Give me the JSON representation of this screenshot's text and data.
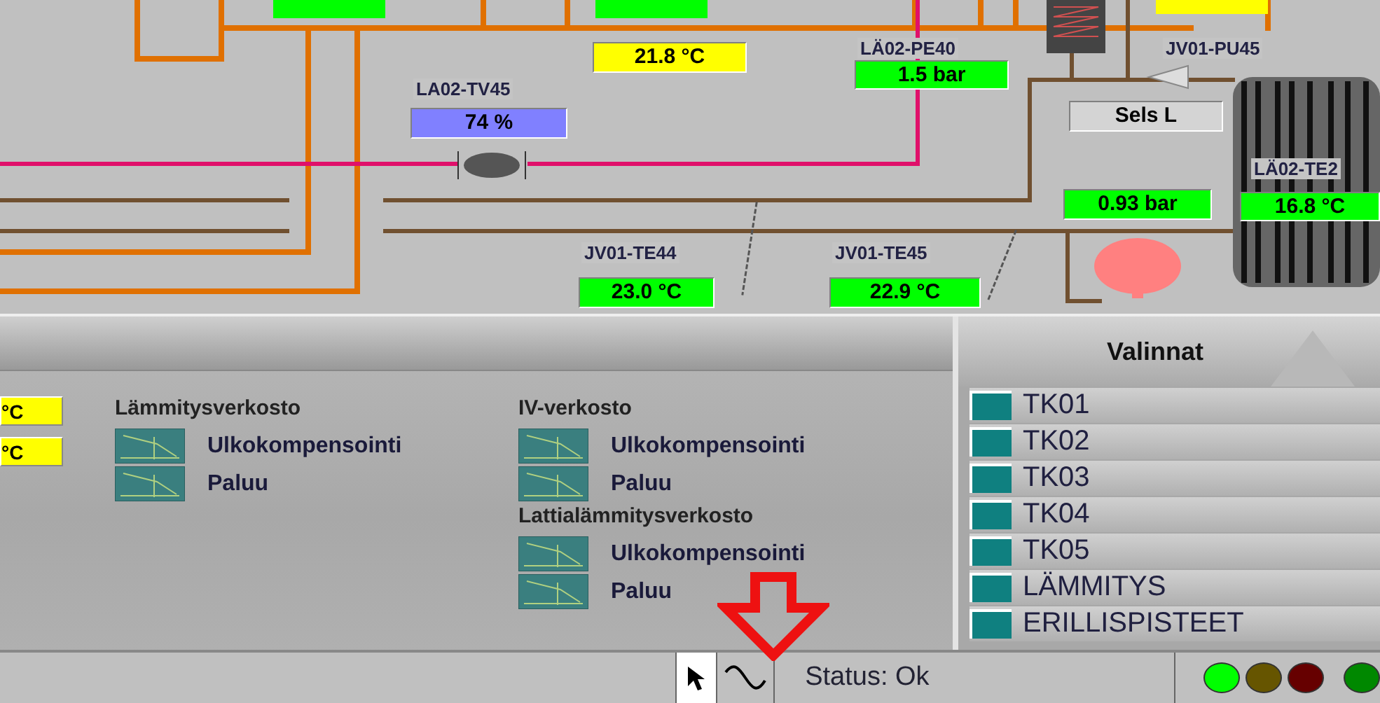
{
  "schematic": {
    "readouts": [
      {
        "value": "21.8 °C",
        "color": "#ffff00"
      },
      {
        "label": "LA02-TV45",
        "value": "74 %",
        "color": "#8080ff"
      },
      {
        "label": "LÄ02-PE40",
        "value": "1.5 bar",
        "color": "#00ff00"
      },
      {
        "label": "JV01-PU45",
        "value": "Sels L",
        "color": "#d4d4d4"
      },
      {
        "value": "0.93 bar",
        "color": "#00ff00"
      },
      {
        "label": "LÄ02-TE2",
        "value": "16.8 °C",
        "color": "#00ff00"
      },
      {
        "label": "JV01-TE44",
        "value": "23.0 °C",
        "color": "#00ff00"
      },
      {
        "label": "JV01-TE45",
        "value": "22.9 °C",
        "color": "#00ff00"
      }
    ]
  },
  "networks": {
    "side_readouts": [
      "°C",
      "°C"
    ],
    "groups": [
      {
        "title": "Lämmitysverkosto",
        "items": [
          "Ulkokompensointi",
          "Paluu"
        ]
      },
      {
        "title": "IV-verkosto",
        "items": [
          "Ulkokompensointi",
          "Paluu"
        ]
      },
      {
        "title": "Lattialämmitysverkosto",
        "items": [
          "Ulkokompensointi",
          "Paluu"
        ]
      }
    ]
  },
  "choices": {
    "title": "Valinnat",
    "items": [
      "TK01",
      "TK02",
      "TK03",
      "TK04",
      "TK05",
      "LÄMMITYS",
      "ERILLISPISTEET"
    ]
  },
  "status_bar": {
    "status": "Status: Ok",
    "lights": [
      {
        "color": "#00ff00"
      },
      {
        "color": "#665500"
      },
      {
        "color": "#660000"
      },
      {
        "color": "#008800"
      }
    ]
  }
}
